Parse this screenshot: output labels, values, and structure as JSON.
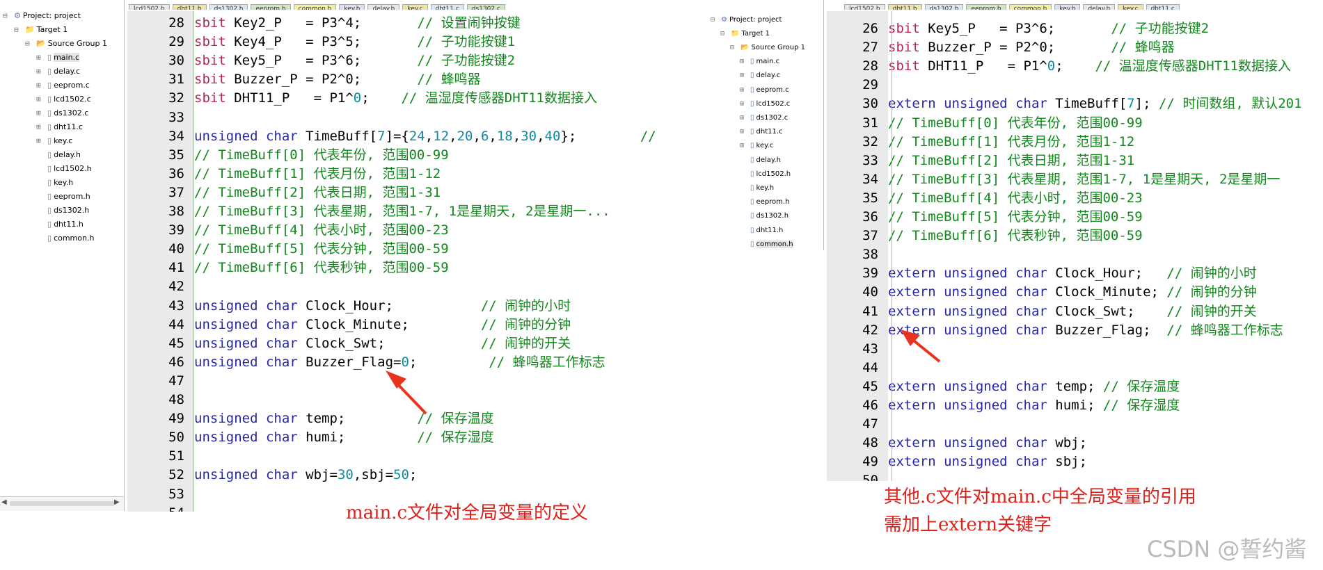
{
  "colors": {
    "sbit": "#b5245a",
    "keyword": "#2626a8",
    "comment": "#12881d",
    "number": "#0d8aa5",
    "caption": "#e0201a",
    "arrow": "#e8341d"
  },
  "left": {
    "tree": [
      {
        "text": "Project: project",
        "level": 0,
        "toggle": "⊟",
        "icon": "project-icon"
      },
      {
        "text": "Target 1",
        "level": 1,
        "toggle": "⊟",
        "icon": "target-folder-icon"
      },
      {
        "text": "Source Group 1",
        "level": 2,
        "toggle": "⊟",
        "icon": "folder-icon"
      },
      {
        "text": "main.c",
        "level": 3,
        "toggle": "⊞",
        "icon": "file-icon",
        "selected": true
      },
      {
        "text": "delay.c",
        "level": 3,
        "toggle": "⊞",
        "icon": "file-icon"
      },
      {
        "text": "eeprom.c",
        "level": 3,
        "toggle": "⊞",
        "icon": "file-icon"
      },
      {
        "text": "lcd1502.c",
        "level": 3,
        "toggle": "⊞",
        "icon": "file-icon"
      },
      {
        "text": "ds1302.c",
        "level": 3,
        "toggle": "⊞",
        "icon": "file-icon"
      },
      {
        "text": "dht11.c",
        "level": 3,
        "toggle": "⊞",
        "icon": "file-icon"
      },
      {
        "text": "key.c",
        "level": 3,
        "toggle": "⊞",
        "icon": "file-icon"
      },
      {
        "text": "delay.h",
        "level": 3,
        "toggle": "",
        "icon": "file-icon"
      },
      {
        "text": "lcd1502.h",
        "level": 3,
        "toggle": "",
        "icon": "file-icon"
      },
      {
        "text": "key.h",
        "level": 3,
        "toggle": "",
        "icon": "file-icon"
      },
      {
        "text": "eeprom.h",
        "level": 3,
        "toggle": "",
        "icon": "file-icon"
      },
      {
        "text": "ds1302.h",
        "level": 3,
        "toggle": "",
        "icon": "file-icon"
      },
      {
        "text": "dht11.h",
        "level": 3,
        "toggle": "",
        "icon": "file-icon"
      },
      {
        "text": "common.h",
        "level": 3,
        "toggle": "",
        "icon": "file-icon"
      }
    ],
    "tabs": [
      "lcd1502.h",
      "dht11.h",
      "ds1302.h",
      "eeprom.h",
      "common.h",
      "key.h",
      "delay.h",
      "key.c",
      "dht11.c",
      "ds1302.c"
    ],
    "lines": [
      {
        "n": "28",
        "tokens": [
          [
            "sbit",
            "sbit"
          ],
          [
            " Key2_P   = P3^4;       ",
            ""
          ],
          [
            "// 设置闹钟按键",
            "cm"
          ]
        ]
      },
      {
        "n": "29",
        "tokens": [
          [
            "sbit",
            "sbit"
          ],
          [
            " Key4_P   = P3^5;       ",
            ""
          ],
          [
            "// 子功能按键1",
            "cm"
          ]
        ]
      },
      {
        "n": "30",
        "tokens": [
          [
            "sbit",
            "sbit"
          ],
          [
            " Key5_P   = P3^6;       ",
            ""
          ],
          [
            "// 子功能按键2",
            "cm"
          ]
        ]
      },
      {
        "n": "31",
        "tokens": [
          [
            "sbit",
            "sbit"
          ],
          [
            " Buzzer_P = P2^0;       ",
            ""
          ],
          [
            "// 蜂鸣器",
            "cm"
          ]
        ]
      },
      {
        "n": "32",
        "tokens": [
          [
            "sbit",
            "sbit"
          ],
          [
            " DHT11_P   = P1^",
            ""
          ],
          [
            "0",
            "nm"
          ],
          [
            ";    ",
            ""
          ],
          [
            "// 温湿度传感器DHT11数据接入",
            "cm"
          ]
        ]
      },
      {
        "n": "33",
        "tokens": []
      },
      {
        "n": "34",
        "tokens": [
          [
            "unsigned",
            "kw"
          ],
          [
            " ",
            ""
          ],
          [
            "char",
            "kw"
          ],
          [
            " TimeBuff[",
            ""
          ],
          [
            "7",
            "nm"
          ],
          [
            "]={",
            ""
          ],
          [
            "24",
            "nm"
          ],
          [
            ",",
            ""
          ],
          [
            "12",
            "nm"
          ],
          [
            ",",
            ""
          ],
          [
            "20",
            "nm"
          ],
          [
            ",",
            ""
          ],
          [
            "6",
            "nm"
          ],
          [
            ",",
            ""
          ],
          [
            "18",
            "nm"
          ],
          [
            ",",
            ""
          ],
          [
            "30",
            "nm"
          ],
          [
            ",",
            ""
          ],
          [
            "40",
            "nm"
          ],
          [
            "};        ",
            ""
          ],
          [
            "//",
            "cm"
          ]
        ]
      },
      {
        "n": "35",
        "tokens": [
          [
            "// TimeBuff[0] 代表年份, 范围00-99",
            "cm"
          ]
        ]
      },
      {
        "n": "36",
        "tokens": [
          [
            "// TimeBuff[1] 代表月份, 范围1-12",
            "cm"
          ]
        ]
      },
      {
        "n": "37",
        "tokens": [
          [
            "// TimeBuff[2] 代表日期, 范围1-31",
            "cm"
          ]
        ]
      },
      {
        "n": "38",
        "tokens": [
          [
            "// TimeBuff[3] 代表星期, 范围1-7, 1是星期天, 2是星期一...",
            "cm"
          ]
        ]
      },
      {
        "n": "39",
        "tokens": [
          [
            "// TimeBuff[4] 代表小时, 范围00-23",
            "cm"
          ]
        ]
      },
      {
        "n": "40",
        "tokens": [
          [
            "// TimeBuff[5] 代表分钟, 范围00-59",
            "cm"
          ]
        ]
      },
      {
        "n": "41",
        "tokens": [
          [
            "// TimeBuff[6] 代表秒钟, 范围00-59",
            "cm"
          ]
        ]
      },
      {
        "n": "42",
        "tokens": []
      },
      {
        "n": "43",
        "tokens": [
          [
            "unsigned",
            "kw"
          ],
          [
            " ",
            ""
          ],
          [
            "char",
            "kw"
          ],
          [
            " Clock_Hour;           ",
            ""
          ],
          [
            "// 闹钟的小时",
            "cm"
          ]
        ]
      },
      {
        "n": "44",
        "tokens": [
          [
            "unsigned",
            "kw"
          ],
          [
            " ",
            ""
          ],
          [
            "char",
            "kw"
          ],
          [
            " Clock_Minute;         ",
            ""
          ],
          [
            "// 闹钟的分钟",
            "cm"
          ]
        ]
      },
      {
        "n": "45",
        "tokens": [
          [
            "unsigned",
            "kw"
          ],
          [
            " ",
            ""
          ],
          [
            "char",
            "kw"
          ],
          [
            " Clock_Swt;            ",
            ""
          ],
          [
            "// 闹钟的开关",
            "cm"
          ]
        ]
      },
      {
        "n": "46",
        "tokens": [
          [
            "unsigned",
            "kw"
          ],
          [
            " ",
            ""
          ],
          [
            "char",
            "kw"
          ],
          [
            " Buzzer_Flag=",
            ""
          ],
          [
            "0",
            "nm"
          ],
          [
            ";         ",
            ""
          ],
          [
            "// 蜂鸣器工作标志",
            "cm"
          ]
        ]
      },
      {
        "n": "47",
        "tokens": []
      },
      {
        "n": "48",
        "tokens": []
      },
      {
        "n": "49",
        "tokens": [
          [
            "unsigned",
            "kw"
          ],
          [
            " ",
            ""
          ],
          [
            "char",
            "kw"
          ],
          [
            " temp;         ",
            ""
          ],
          [
            "// 保存温度",
            "cm"
          ]
        ]
      },
      {
        "n": "50",
        "tokens": [
          [
            "unsigned",
            "kw"
          ],
          [
            " ",
            ""
          ],
          [
            "char",
            "kw"
          ],
          [
            " humi;         ",
            ""
          ],
          [
            "// 保存湿度",
            "cm"
          ]
        ]
      },
      {
        "n": "51",
        "tokens": []
      },
      {
        "n": "52",
        "tokens": [
          [
            "unsigned",
            "kw"
          ],
          [
            " ",
            ""
          ],
          [
            "char",
            "kw"
          ],
          [
            " wbj=",
            ""
          ],
          [
            "30",
            "nm"
          ],
          [
            ",sbj=",
            ""
          ],
          [
            "50",
            "nm"
          ],
          [
            ";",
            ""
          ]
        ]
      },
      {
        "n": "53",
        "tokens": []
      },
      {
        "n": "54",
        "tokens": []
      }
    ],
    "caption": "main.c文件对全局变量的定义"
  },
  "right": {
    "tree": [
      {
        "text": "Project: project",
        "level": 0,
        "toggle": "⊟",
        "icon": "project-icon"
      },
      {
        "text": "Target 1",
        "level": 1,
        "toggle": "⊟",
        "icon": "target-folder-icon"
      },
      {
        "text": "Source Group 1",
        "level": 2,
        "toggle": "⊟",
        "icon": "folder-icon"
      },
      {
        "text": "main.c",
        "level": 3,
        "toggle": "⊞",
        "icon": "file-icon"
      },
      {
        "text": "delay.c",
        "level": 3,
        "toggle": "⊞",
        "icon": "file-icon"
      },
      {
        "text": "eeprom.c",
        "level": 3,
        "toggle": "⊞",
        "icon": "file-icon"
      },
      {
        "text": "lcd1502.c",
        "level": 3,
        "toggle": "⊞",
        "icon": "file-icon"
      },
      {
        "text": "ds1302.c",
        "level": 3,
        "toggle": "⊞",
        "icon": "file-icon"
      },
      {
        "text": "dht11.c",
        "level": 3,
        "toggle": "⊞",
        "icon": "file-icon"
      },
      {
        "text": "key.c",
        "level": 3,
        "toggle": "⊞",
        "icon": "file-icon"
      },
      {
        "text": "delay.h",
        "level": 3,
        "toggle": "",
        "icon": "file-icon"
      },
      {
        "text": "lcd1502.h",
        "level": 3,
        "toggle": "",
        "icon": "file-icon"
      },
      {
        "text": "key.h",
        "level": 3,
        "toggle": "",
        "icon": "file-icon"
      },
      {
        "text": "eeprom.h",
        "level": 3,
        "toggle": "",
        "icon": "file-icon"
      },
      {
        "text": "ds1302.h",
        "level": 3,
        "toggle": "",
        "icon": "file-icon"
      },
      {
        "text": "dht11.h",
        "level": 3,
        "toggle": "",
        "icon": "file-icon"
      },
      {
        "text": "common.h",
        "level": 3,
        "toggle": "",
        "icon": "file-icon",
        "selected": true
      }
    ],
    "tabs": [
      "lcd1502.h",
      "dht11.h",
      "ds1302.h",
      "eeprom.h",
      "common.h",
      "key.h",
      "delay.h",
      "key.c",
      "dht11.c"
    ],
    "lines": [
      {
        "n": "26",
        "tokens": [
          [
            "sbit",
            "sbit"
          ],
          [
            " Key5_P   = P3^6;       ",
            ""
          ],
          [
            "// 子功能按键2",
            "cm"
          ]
        ]
      },
      {
        "n": "27",
        "tokens": [
          [
            "sbit",
            "sbit"
          ],
          [
            " Buzzer_P = P2^0;       ",
            ""
          ],
          [
            "// 蜂鸣器",
            "cm"
          ]
        ]
      },
      {
        "n": "28",
        "tokens": [
          [
            "sbit",
            "sbit"
          ],
          [
            " DHT11_P   = P1^",
            ""
          ],
          [
            "0",
            "nm"
          ],
          [
            ";    ",
            ""
          ],
          [
            "// 温湿度传感器DHT11数据接入",
            "cm"
          ]
        ]
      },
      {
        "n": "29",
        "tokens": []
      },
      {
        "n": "30",
        "tokens": [
          [
            "extern",
            "kw"
          ],
          [
            " ",
            ""
          ],
          [
            "unsigned",
            "kw"
          ],
          [
            " ",
            ""
          ],
          [
            "char",
            "kw"
          ],
          [
            " TimeBuff[",
            ""
          ],
          [
            "7",
            "nm"
          ],
          [
            "]; ",
            ""
          ],
          [
            "// 时间数组, 默认201",
            "cm"
          ]
        ]
      },
      {
        "n": "31",
        "tokens": [
          [
            "// TimeBuff[0] 代表年份, 范围00-99",
            "cm"
          ]
        ]
      },
      {
        "n": "32",
        "tokens": [
          [
            "// TimeBuff[1] 代表月份, 范围1-12",
            "cm"
          ]
        ]
      },
      {
        "n": "33",
        "tokens": [
          [
            "// TimeBuff[2] 代表日期, 范围1-31",
            "cm"
          ]
        ]
      },
      {
        "n": "34",
        "tokens": [
          [
            "// TimeBuff[3] 代表星期, 范围1-7, 1是星期天, 2是星期一",
            "cm"
          ]
        ]
      },
      {
        "n": "35",
        "tokens": [
          [
            "// TimeBuff[4] 代表小时, 范围00-23",
            "cm"
          ]
        ]
      },
      {
        "n": "36",
        "tokens": [
          [
            "// TimeBuff[5] 代表分钟, 范围00-59",
            "cm"
          ]
        ]
      },
      {
        "n": "37",
        "tokens": [
          [
            "// TimeBuff[6] 代表秒钟, 范围00-59",
            "cm"
          ]
        ]
      },
      {
        "n": "38",
        "tokens": []
      },
      {
        "n": "39",
        "tokens": [
          [
            "extern",
            "kw"
          ],
          [
            " ",
            ""
          ],
          [
            "unsigned",
            "kw"
          ],
          [
            " ",
            ""
          ],
          [
            "char",
            "kw"
          ],
          [
            " Clock_Hour;   ",
            ""
          ],
          [
            "// 闹钟的小时",
            "cm"
          ]
        ]
      },
      {
        "n": "40",
        "tokens": [
          [
            "extern",
            "kw"
          ],
          [
            " ",
            ""
          ],
          [
            "unsigned",
            "kw"
          ],
          [
            " ",
            ""
          ],
          [
            "char",
            "kw"
          ],
          [
            " Clock_Minute; ",
            ""
          ],
          [
            "// 闹钟的分钟",
            "cm"
          ]
        ]
      },
      {
        "n": "41",
        "tokens": [
          [
            "extern",
            "kw"
          ],
          [
            " ",
            ""
          ],
          [
            "unsigned",
            "kw"
          ],
          [
            " ",
            ""
          ],
          [
            "char",
            "kw"
          ],
          [
            " Clock_Swt;    ",
            ""
          ],
          [
            "// 闹钟的开关",
            "cm"
          ]
        ]
      },
      {
        "n": "42",
        "tokens": [
          [
            "extern",
            "kw"
          ],
          [
            " ",
            ""
          ],
          [
            "unsigned",
            "kw"
          ],
          [
            " ",
            ""
          ],
          [
            "char",
            "kw"
          ],
          [
            " Buzzer_Flag;  ",
            ""
          ],
          [
            "// 蜂鸣器工作标志",
            "cm"
          ]
        ]
      },
      {
        "n": "43",
        "tokens": []
      },
      {
        "n": "44",
        "tokens": []
      },
      {
        "n": "45",
        "tokens": [
          [
            "extern",
            "kw"
          ],
          [
            " ",
            ""
          ],
          [
            "unsigned",
            "kw"
          ],
          [
            " ",
            ""
          ],
          [
            "char",
            "kw"
          ],
          [
            " temp; ",
            ""
          ],
          [
            "// 保存温度",
            "cm"
          ]
        ]
      },
      {
        "n": "46",
        "tokens": [
          [
            "extern",
            "kw"
          ],
          [
            " ",
            ""
          ],
          [
            "unsigned",
            "kw"
          ],
          [
            " ",
            ""
          ],
          [
            "char",
            "kw"
          ],
          [
            " humi; ",
            ""
          ],
          [
            "// 保存湿度",
            "cm"
          ]
        ]
      },
      {
        "n": "47",
        "tokens": []
      },
      {
        "n": "48",
        "tokens": [
          [
            "extern",
            "kw"
          ],
          [
            " ",
            ""
          ],
          [
            "unsigned",
            "kw"
          ],
          [
            " ",
            ""
          ],
          [
            "char",
            "kw"
          ],
          [
            " wbj;",
            ""
          ]
        ]
      },
      {
        "n": "49",
        "tokens": [
          [
            "extern",
            "kw"
          ],
          [
            " ",
            ""
          ],
          [
            "unsigned",
            "kw"
          ],
          [
            " ",
            ""
          ],
          [
            "char",
            "kw"
          ],
          [
            " sbj;",
            ""
          ]
        ]
      },
      {
        "n": "50",
        "tokens": []
      }
    ],
    "caption_lines": [
      "其他.c文件对main.c中全局变量的引用",
      "需加上extern关键字"
    ]
  },
  "watermark": "CSDN @誓约酱"
}
